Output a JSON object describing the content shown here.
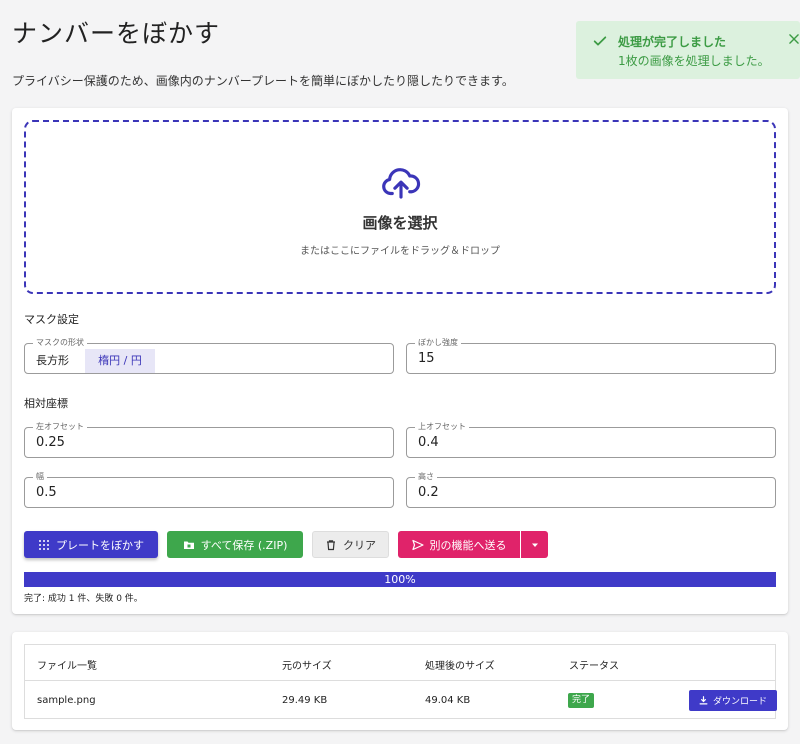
{
  "page": {
    "title": "ナンバーをぼかす",
    "description": "プライバシー保護のため、画像内のナンバープレートを簡単にぼかしたり隠したりできます。"
  },
  "toast": {
    "title": "処理が完了しました",
    "message": "1枚の画像を処理しました。",
    "icon": "check-icon",
    "close_icon": "close-icon"
  },
  "dropzone": {
    "icon": "cloud-upload-icon",
    "title": "画像を選択",
    "subtitle": "またはここにファイルをドラッグ＆ドロップ"
  },
  "mask_settings": {
    "label": "マスク設定",
    "shape": {
      "legend": "マスクの形状",
      "options": [
        "長方形",
        "楕円 / 円"
      ],
      "selected": "楕円 / 円"
    },
    "blur": {
      "legend": "ぼかし強度",
      "value": "15"
    }
  },
  "relative_coords": {
    "label": "相対座標",
    "left_offset": {
      "legend": "左オフセット",
      "value": "0.25"
    },
    "top_offset": {
      "legend": "上オフセット",
      "value": "0.4"
    },
    "width": {
      "legend": "幅",
      "value": "0.5"
    },
    "height": {
      "legend": "高さ",
      "value": "0.2"
    }
  },
  "actions": {
    "blur_plate": "プレートをぼかす",
    "save_all": "すべて保存 (.ZIP)",
    "clear": "クリア",
    "send": "別の機能へ送る"
  },
  "progress": {
    "percent": 100,
    "text": "100%",
    "status": "完了: 成功 1 件、失敗 0 件。"
  },
  "files_table": {
    "columns": [
      "ファイル一覧",
      "元のサイズ",
      "処理後のサイズ",
      "ステータス"
    ],
    "rows": [
      {
        "name": "sample.png",
        "original_size": "29.49 KB",
        "processed_size": "49.04 KB",
        "status": "完了",
        "action": "ダウンロード"
      }
    ]
  },
  "colors": {
    "primary": "#3f3ac8",
    "success": "#3ea74c",
    "accent": "#e0236a",
    "toast_bg": "#dcf1de"
  }
}
